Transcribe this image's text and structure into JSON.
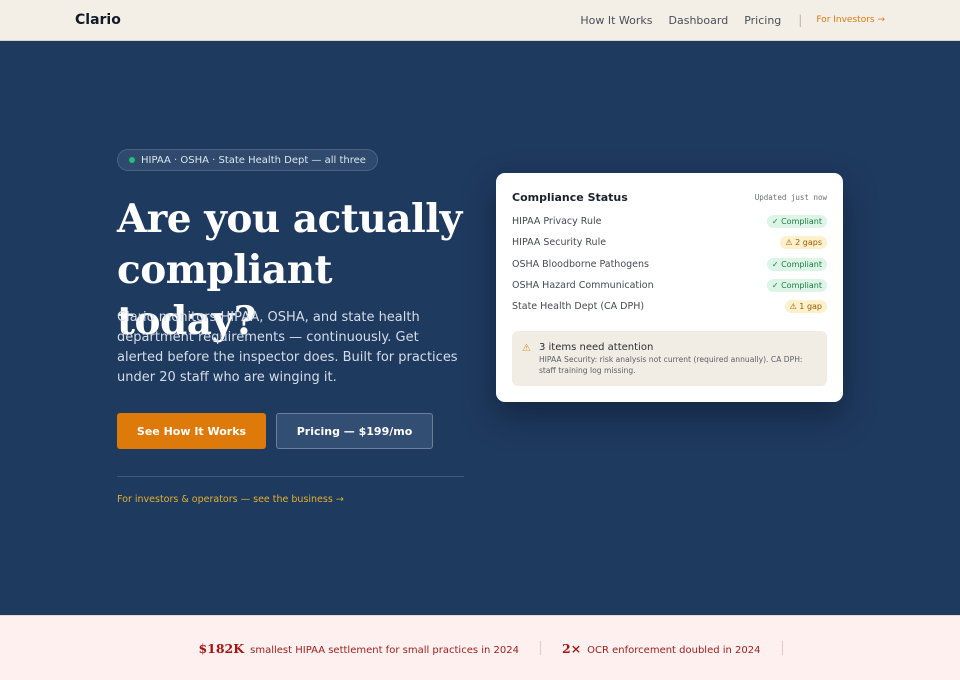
{
  "nav": {
    "logo": "Clario",
    "links": [
      "How It Works",
      "Dashboard",
      "Pricing"
    ],
    "separator": "|",
    "investors": "For Investors →"
  },
  "hero": {
    "pill": "HIPAA · OSHA · State Health Dept — all three",
    "headline": "Are you actually compliant today?",
    "subtext": "Clario monitors HIPAA, OSHA, and state health department requirements — continuously. Get alerted before the inspector does. Built for practices under 20 staff who are winging it.",
    "primary_cta": "See How It Works",
    "secondary_cta": "Pricing — $199/mo",
    "investor_link": "For investors & operators — see the business →"
  },
  "card": {
    "title": "Compliance Status",
    "updated": "Updated just now",
    "rows": [
      {
        "label": "HIPAA Privacy Rule",
        "status": "✓ Compliant",
        "state": "ok"
      },
      {
        "label": "HIPAA Security Rule",
        "status": "⚠ 2 gaps",
        "state": "warn"
      },
      {
        "label": "OSHA Bloodborne Pathogens",
        "status": "✓ Compliant",
        "state": "ok"
      },
      {
        "label": "OSHA Hazard Communication",
        "status": "✓ Compliant",
        "state": "ok"
      },
      {
        "label": "State Health Dept (CA DPH)",
        "status": "⚠ 1 gap",
        "state": "warn"
      }
    ],
    "alert": {
      "icon": "⚠",
      "title": "3 items need attention",
      "text": "HIPAA Security: risk analysis not current (required annually). CA DPH: staff training log missing."
    }
  },
  "stats": [
    {
      "number": "$182K",
      "text": "smallest HIPAA settlement for small practices in 2024"
    },
    {
      "number": "2×",
      "text": "OCR enforcement doubled in 2024"
    }
  ],
  "colors": {
    "hero_bg": "#1f3a5f",
    "nav_bg": "#f3efe7",
    "accent_orange": "#de7a0a",
    "accent_gold": "#e3b02e",
    "ok_green": "#1d7a44",
    "warn_amber": "#9a5b00",
    "stat_red": "#a31414"
  }
}
